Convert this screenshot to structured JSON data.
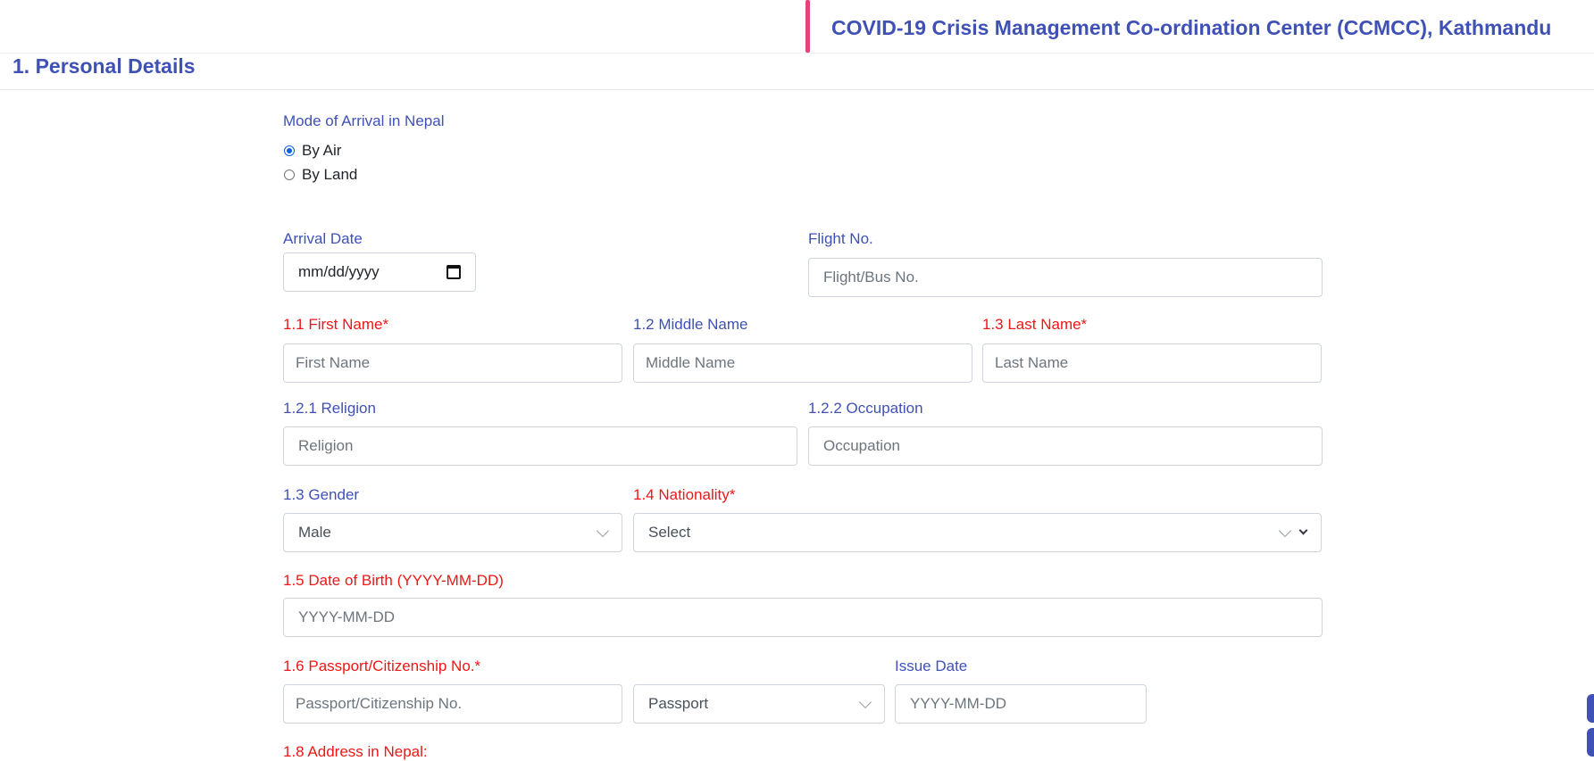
{
  "header": {
    "title": "COVID-19 Crisis Management Co-ordination Center (CCMCC), Kathmandu",
    "accent_color": "#e8407a",
    "brand_color": "#3f51b5"
  },
  "section": {
    "title": "1. Personal Details"
  },
  "arrival_mode": {
    "label": "Mode of Arrival in Nepal",
    "options": [
      {
        "label": "By Air",
        "selected": true
      },
      {
        "label": "By Land",
        "selected": false
      }
    ]
  },
  "arrival_date": {
    "label": "Arrival Date",
    "placeholder": "mm/dd/yyyy",
    "icon": "calendar-icon"
  },
  "flight_no": {
    "label": "Flight No.",
    "placeholder": "Flight/Bus No."
  },
  "first_name": {
    "label": "1.1 First Name*",
    "placeholder": "First Name"
  },
  "middle_name": {
    "label": "1.2 Middle Name",
    "placeholder": "Middle Name"
  },
  "last_name": {
    "label": "1.3 Last Name*",
    "placeholder": "Last Name"
  },
  "religion": {
    "label": "1.2.1 Religion",
    "placeholder": "Religion"
  },
  "occupation": {
    "label": "1.2.2 Occupation",
    "placeholder": "Occupation"
  },
  "gender": {
    "label": "1.3 Gender",
    "value": "Male"
  },
  "nationality": {
    "label": "1.4 Nationality*",
    "value": "Select"
  },
  "dob": {
    "label": "1.5 Date of Birth (YYYY-MM-DD)",
    "placeholder": "YYYY-MM-DD"
  },
  "passport": {
    "label": "1.6 Passport/Citizenship No.*",
    "placeholder": "Passport/Citizenship No.",
    "doc_type": "Passport"
  },
  "issue_date": {
    "label": "Issue Date",
    "placeholder": "YYYY-MM-DD"
  },
  "address": {
    "label": "1.8 Address in Nepal:"
  }
}
